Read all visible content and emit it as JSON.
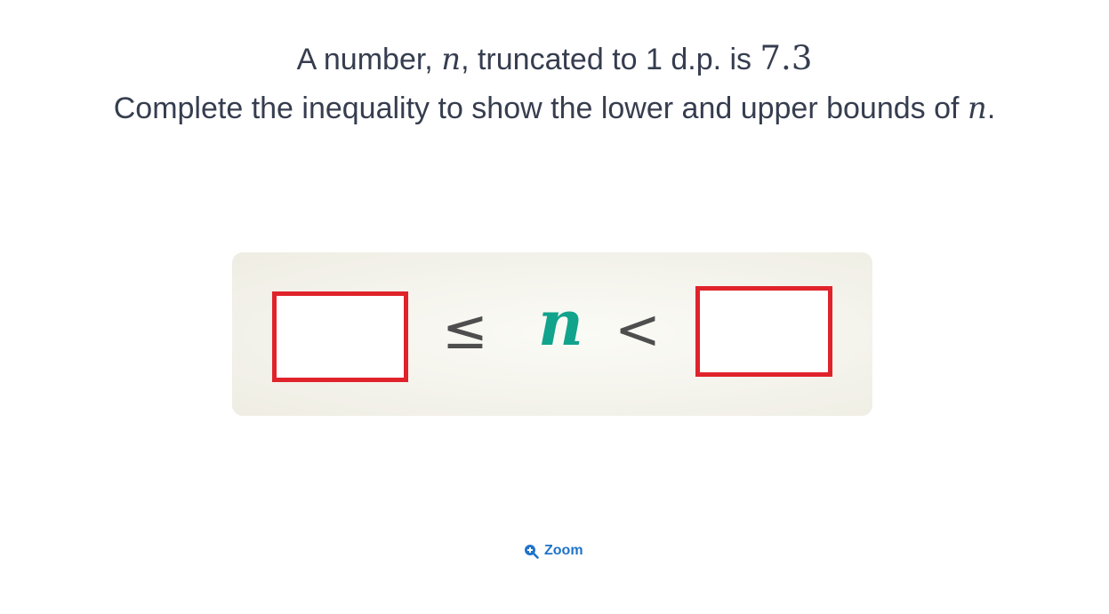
{
  "question": {
    "line1_prefix": "A number, ",
    "variable": "n",
    "line1_middle": ", truncated to 1 d.p. is ",
    "value": "7.3",
    "line2_prefix": "Complete the inequality to show the lower and upper bounds of ",
    "line2_suffix": "."
  },
  "inequality": {
    "lower_bound_value": "",
    "lower_symbol": "≤",
    "variable": "n",
    "upper_symbol": "<",
    "upper_bound_value": ""
  },
  "zoom": {
    "label": "Zoom",
    "icon": "zoom-in-icon"
  },
  "colors": {
    "text": "#363d4f",
    "variable_accent": "#12a38c",
    "answer_box_border": "#e0232b",
    "card_background": "#f4f3ec",
    "link": "#1f73c9"
  }
}
